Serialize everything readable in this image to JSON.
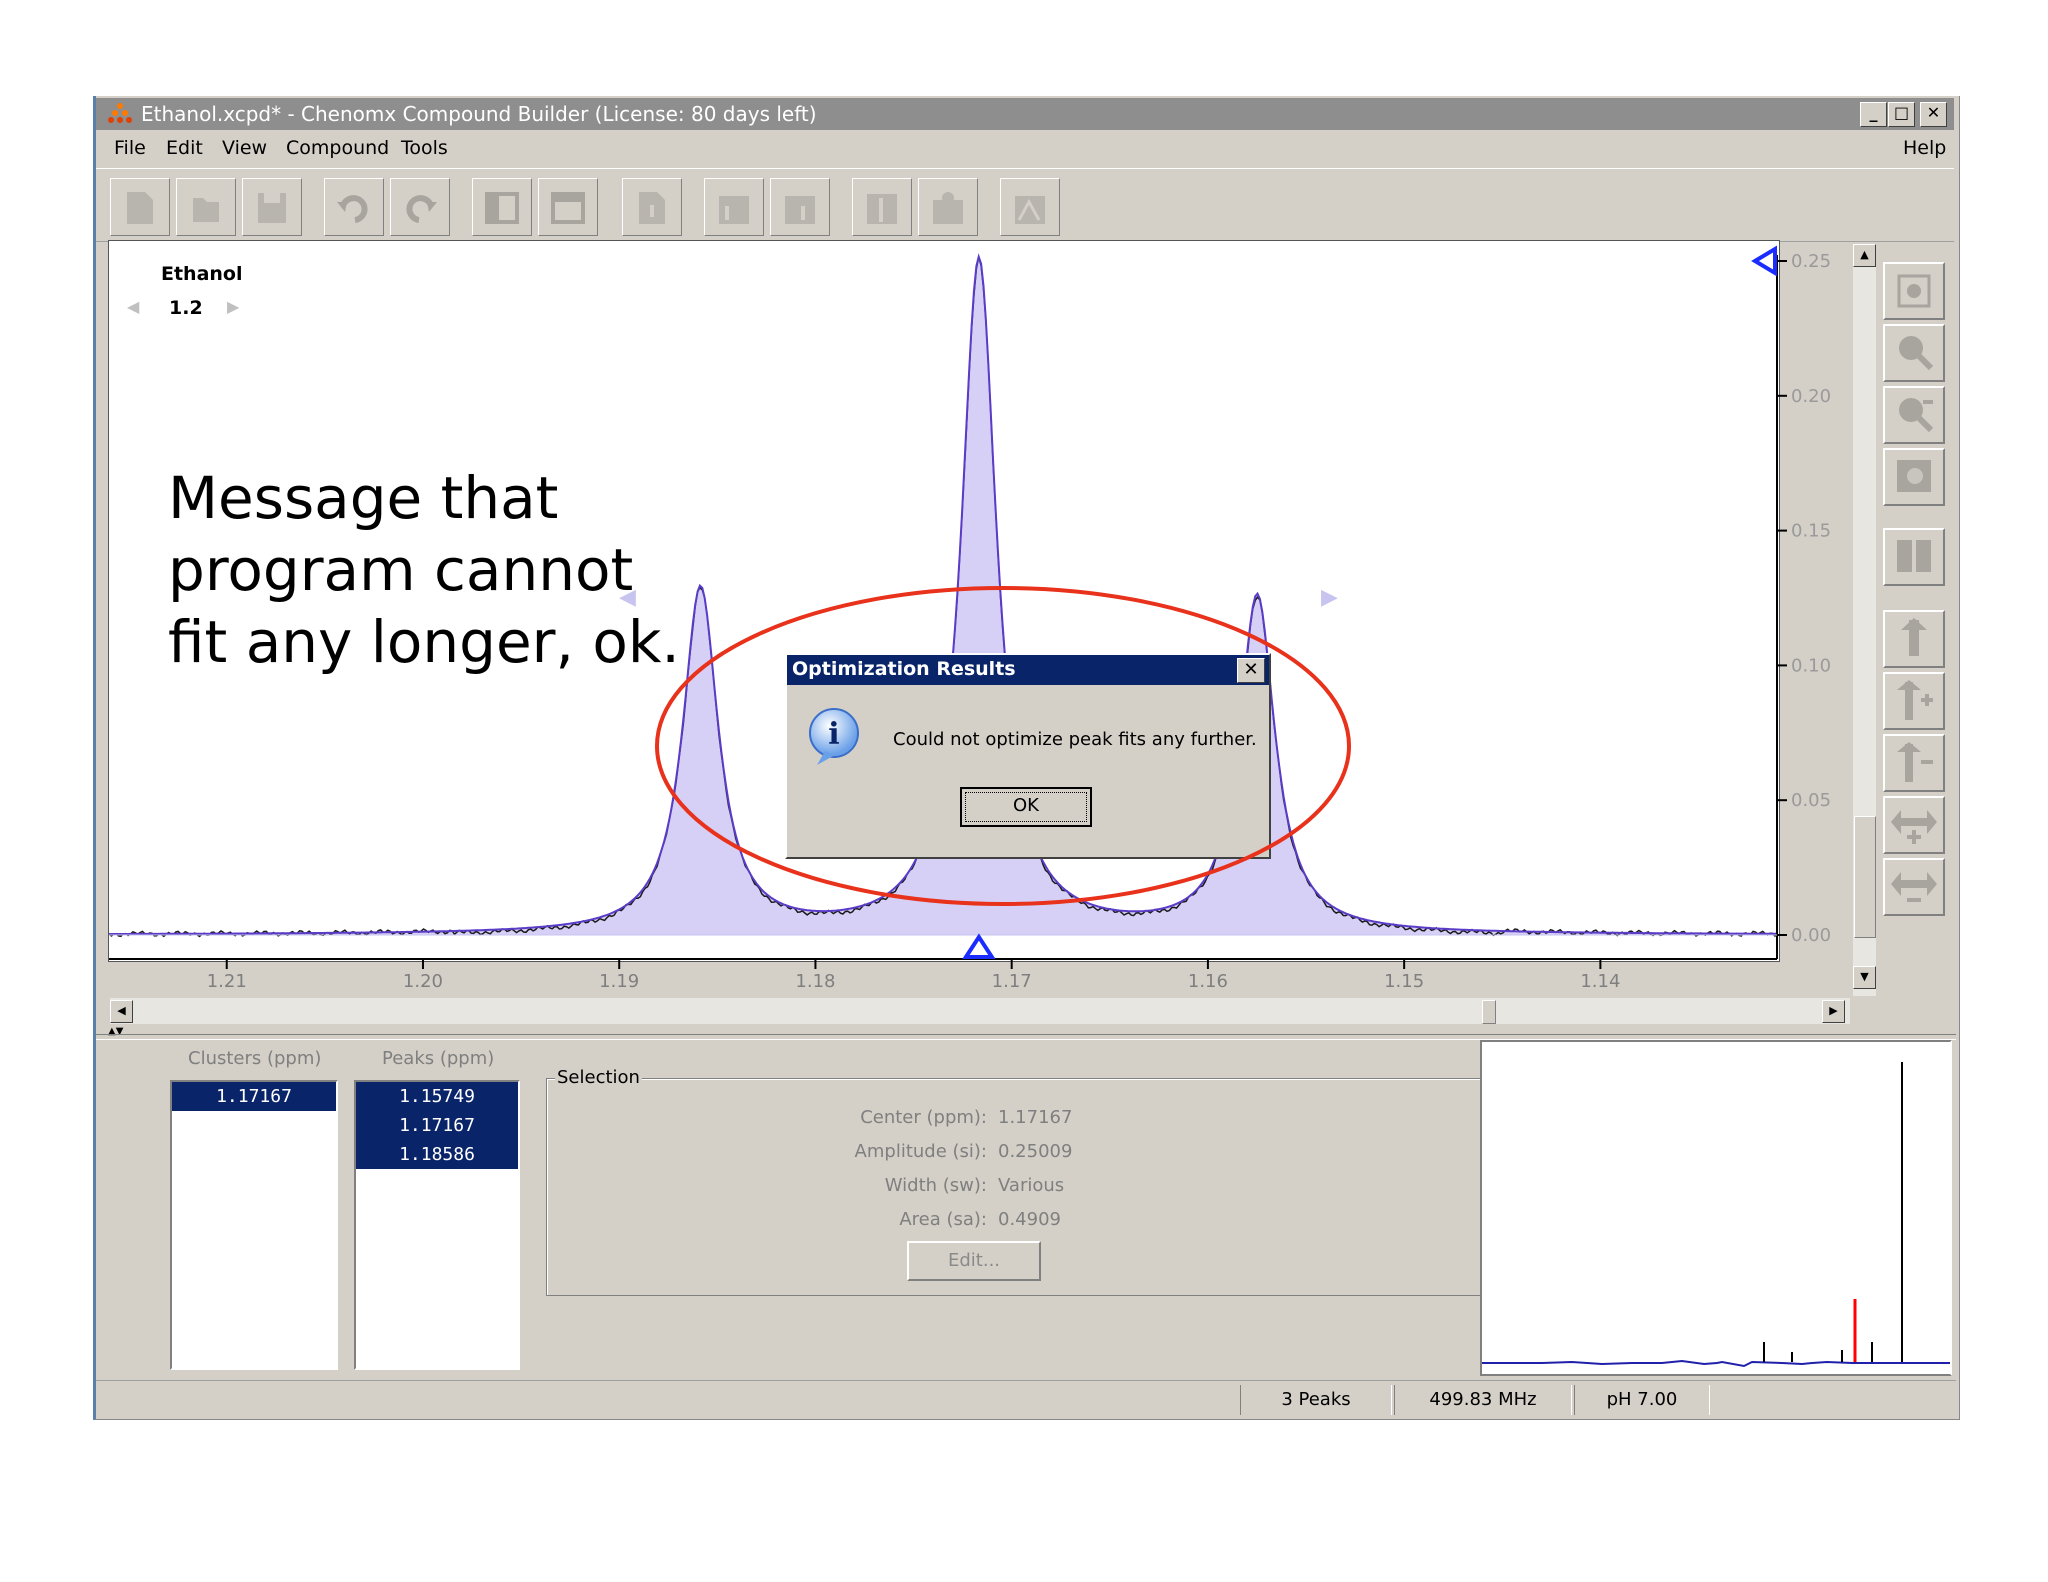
{
  "window": {
    "title": "Ethanol.xcpd* - Chenomx Compound Builder (License: 80 days left)",
    "min_label": "_",
    "max_label": "□",
    "close_label": "✕"
  },
  "menu": {
    "items": [
      "File",
      "Edit",
      "View",
      "Compound",
      "Tools"
    ],
    "help": "Help"
  },
  "toolbar": {
    "buttons": [
      "new-document-icon",
      "open-icon",
      "save-icon",
      "undo-icon",
      "redo-icon",
      "panel-left-icon",
      "panel-right-icon",
      "info-document-icon",
      "add-chart-icon",
      "remove-chart-icon",
      "cluster-chart-icon",
      "cluster-edit-icon",
      "peak-chart-icon"
    ]
  },
  "spectrum": {
    "compound_name": "Ethanol",
    "cluster_value": "1.2",
    "y_ticks": [
      "0.25",
      "0.20",
      "0.15",
      "0.10",
      "0.05",
      "0.00"
    ],
    "x_ticks": [
      "1.21",
      "1.20",
      "1.19",
      "1.18",
      "1.17",
      "1.16",
      "1.15",
      "1.14"
    ]
  },
  "chart_data": {
    "type": "line",
    "xlabel": "",
    "ylabel": "",
    "xlim": [
      1.216,
      1.131
    ],
    "ylim": [
      0.0,
      0.25
    ],
    "x_ticks": [
      1.21,
      1.2,
      1.19,
      1.18,
      1.17,
      1.16,
      1.15,
      1.14
    ],
    "y_ticks": [
      0.0,
      0.05,
      0.1,
      0.15,
      0.2,
      0.25
    ],
    "series": [
      {
        "type": "peak",
        "center": 1.18586,
        "amplitude": 0.128
      },
      {
        "type": "peak",
        "center": 1.17167,
        "amplitude": 0.25009
      },
      {
        "type": "peak",
        "center": 1.15749,
        "amplitude": 0.125
      }
    ]
  },
  "right_tools": [
    "zoom-fit-icon",
    "zoom-in-icon",
    "zoom-out-icon",
    "zoom-box-icon",
    "columns-icon",
    "vertical-shift-icon",
    "vertical-expand-icon",
    "vertical-shrink-icon",
    "horizontal-expand-icon",
    "horizontal-shrink-icon"
  ],
  "lists": {
    "clusters_header": "Clusters (ppm)",
    "clusters": [
      "1.17167"
    ],
    "peaks_header": "Peaks (ppm)",
    "peaks": [
      "1.15749",
      "1.17167",
      "1.18586"
    ]
  },
  "selection": {
    "group_label": "Selection",
    "center_label": "Center (ppm):",
    "center_value": "1.17167",
    "amplitude_label": "Amplitude (si):",
    "amplitude_value": "0.25009",
    "width_label": "Width (sw):",
    "width_value": "Various",
    "area_label": "Area (sa):",
    "area_value": "0.4909",
    "edit_button": "Edit..."
  },
  "status": {
    "peaks": "3 Peaks",
    "frequency": "499.83 MHz",
    "ph": "pH 7.00"
  },
  "dialog": {
    "title": "Optimization Results",
    "message": "Could not optimize peak fits any further.",
    "ok": "OK",
    "close": "✕"
  },
  "annotation": {
    "text": "Message that program cannot fit any longer, ok.",
    "highlight_color": "#e8321c"
  }
}
